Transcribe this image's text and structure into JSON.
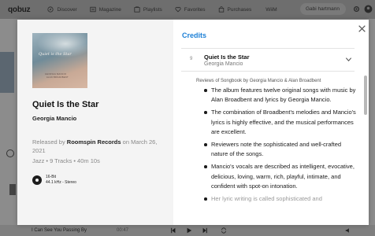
{
  "app": {
    "logo": "qobuz"
  },
  "nav": {
    "items": [
      {
        "label": "Discover",
        "icon": "compass-icon"
      },
      {
        "label": "Magazine",
        "icon": "magazine-icon"
      },
      {
        "label": "Playlists",
        "icon": "playlist-icon"
      },
      {
        "label": "Favorites",
        "icon": "heart-icon"
      },
      {
        "label": "Purchases",
        "icon": "bag-icon"
      },
      {
        "label": "WiiM",
        "icon": ""
      }
    ],
    "search_placeholder": "Gabi hartmann"
  },
  "album": {
    "cover_title": "Quiet is the Star",
    "cover_line1": "GEORGIA MANCIO",
    "cover_line2": "ALAN BROADBENT",
    "title": "Quiet Is the Star",
    "artist": "Georgia Mancio",
    "released_prefix": "Released by",
    "label": "Roomspin Records",
    "released_suffix": "on March 26, 2021",
    "genre": "Jazz",
    "tracks": "9 Tracks",
    "duration": "40m 10s",
    "quality_bits": "16-Bit",
    "quality_rate": "44.1 kHz - Stereo"
  },
  "credits": {
    "title": "Credits",
    "track_number": "9",
    "track_title": "Quiet Is the Star",
    "track_artist": "Georgia Mancio",
    "reviews_heading": "Reviews of Songbook by Georgia Mancio & Alan Broadbent",
    "reviews": [
      "The album features twelve original songs with music by Alan Broadbent and lyrics by Georgia Mancio.",
      "The combination of Broadbent's melodies and Mancio's lyrics is highly effective, and the musical performances are excellent.",
      "Reviewers note the sophisticated and well-crafted nature of the songs.",
      "Mancio's vocals are described as intelligent, evocative, delicious, loving, warm, rich, playful, intimate, and confident with spot-on intonation.",
      "Her lyric writing is called sophisticated and"
    ]
  },
  "player": {
    "track": "I Can See You Passing By",
    "time": "00:47"
  }
}
